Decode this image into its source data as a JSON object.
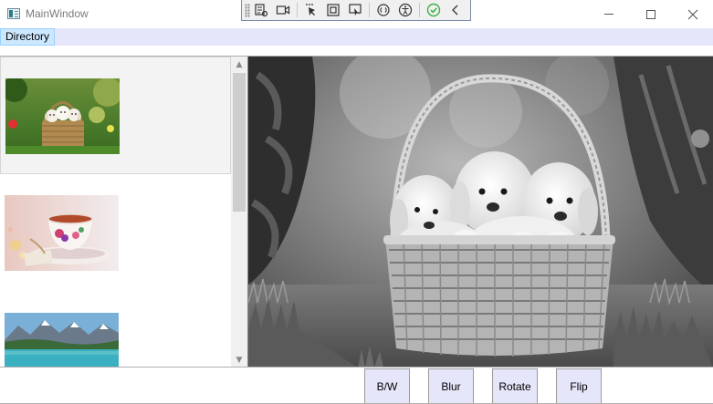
{
  "window": {
    "title": "MainWindow"
  },
  "menu": {
    "items": [
      {
        "label": "Directory"
      }
    ]
  },
  "image_list": {
    "items": [
      {
        "name": "puppies-basket-thumbnail",
        "selected": true
      },
      {
        "name": "teacup-thumbnail",
        "selected": false
      },
      {
        "name": "mountain-lake-thumbnail",
        "selected": false
      }
    ]
  },
  "preview": {
    "description_icon": "puppies-basket-grayscale-image"
  },
  "actions": {
    "bw_label": "B/W",
    "blur_label": "Blur",
    "rotate_label": "Rotate",
    "flip_label": "Flip"
  },
  "colors": {
    "menubar_bg": "#e6e6fa",
    "button_bg": "#e6e6fa",
    "menu_selected_bg": "#cce8ff",
    "debug_check": "#3cb043"
  }
}
